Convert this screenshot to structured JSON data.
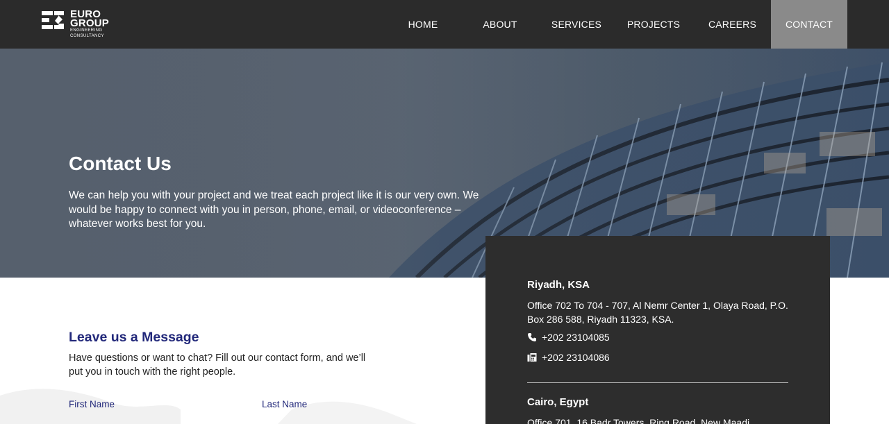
{
  "logo": {
    "line1": "EURO",
    "line2": "GROUP",
    "sub1": "ENGINEERING",
    "sub2": "CONSULTANCY"
  },
  "nav": [
    {
      "label": "HOME",
      "active": false
    },
    {
      "label": "ABOUT",
      "active": false
    },
    {
      "label": "SERVICES",
      "active": false
    },
    {
      "label": "PROJECTS",
      "active": false
    },
    {
      "label": "CAREERS",
      "active": false
    },
    {
      "label": "CONTACT",
      "active": true
    }
  ],
  "hero": {
    "title": "Contact Us",
    "text": "We can help you with your project and we treat each project like it is our very own. We would be happy to connect with you in person, phone, email, or videoconference – whatever works best for you."
  },
  "message": {
    "title": "Leave us a Message",
    "text": "Have questions or want to chat? Fill out our contact form, and we’ll put you in touch with the right people.",
    "first_name_label": "First Name",
    "last_name_label": "Last Name"
  },
  "offices": [
    {
      "city": "Riyadh, KSA",
      "address": "Office 702 To 704 - 707, Al Nemr Center 1, Olaya Road, P.O. Box 286 588, Riyadh 11323, KSA.",
      "phone": "+202 23104085",
      "fax": "+202 23104086"
    },
    {
      "city": "Cairo, Egypt",
      "address": "Office 701, 16 Badr Towers, Ring Road, New Maadi"
    }
  ],
  "colors": {
    "header": "#2b2b2b",
    "accent_text": "#22287a",
    "card": "#2d2d2d",
    "nav_active": "#8a8a8a"
  }
}
